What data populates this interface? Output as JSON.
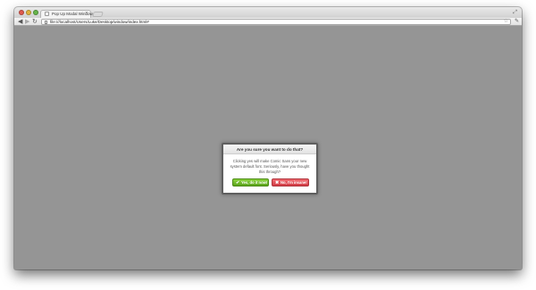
{
  "browser": {
    "tab_title": "Pop Up Modal Window",
    "tab_close": "×",
    "url": "file:///localhost/Users/Luke/Desktop/window/index.html#"
  },
  "icons": {
    "back": "back-arrow-icon",
    "forward": "forward-arrow-icon",
    "reload": "reload-icon",
    "star": "star-icon",
    "wrench": "wrench-icon",
    "check": "check-icon",
    "cross": "cross-icon"
  },
  "modal": {
    "title": "Are you sure you want to do that?",
    "message": "Clicking yes will make Comic Sans your new system default font. Seriously, have you thought this through?",
    "yes_label": "Yes, do it now!",
    "no_label": "No, I'm insane!"
  },
  "colors": {
    "overlay": "#959595",
    "yes_button": "#6bb92a",
    "no_button": "#e04f57"
  }
}
